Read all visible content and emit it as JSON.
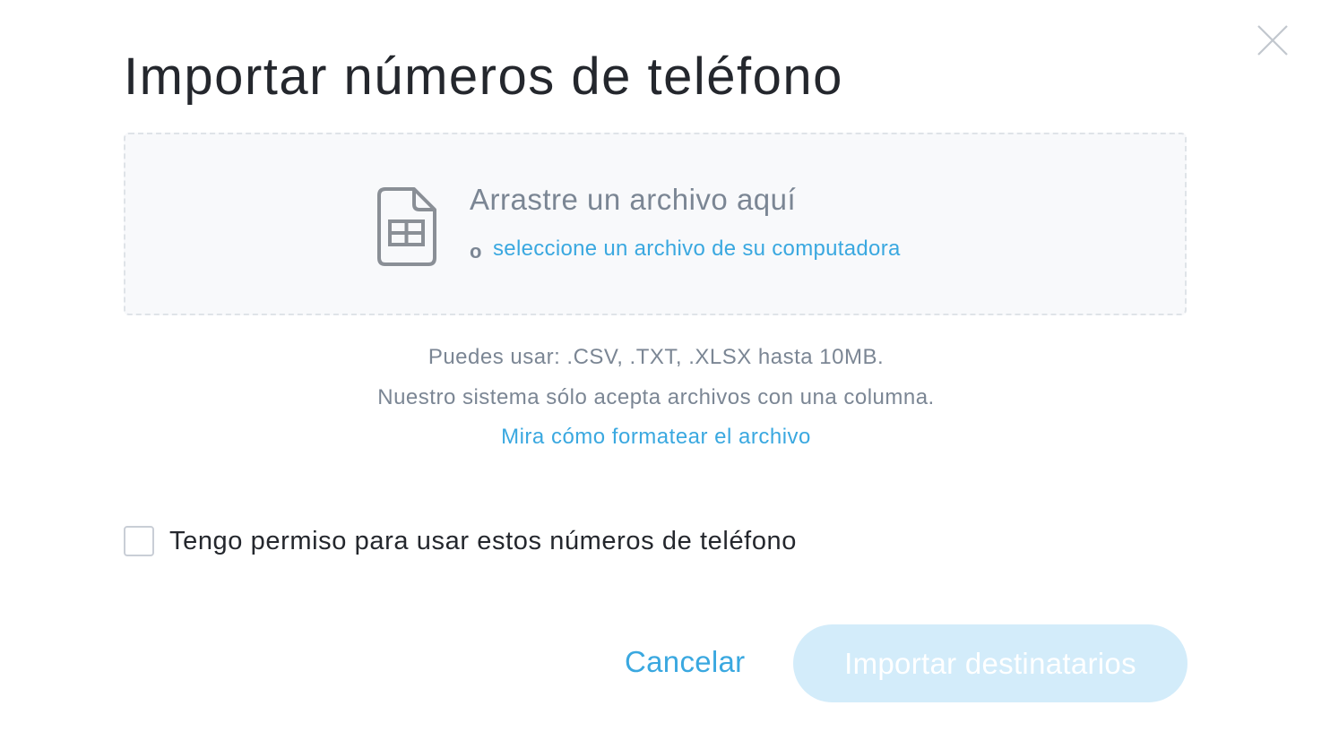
{
  "dialog": {
    "title": "Importar números de teléfono",
    "close_icon": "close-icon"
  },
  "dropzone": {
    "icon": "spreadsheet-file-icon",
    "title": "Arrastre un archivo aquí",
    "or_text": "o",
    "select_link": "seleccione un archivo de su computadora"
  },
  "info": {
    "formats": "Puedes usar: .CSV, .TXT, .XLSX hasta 10MB.",
    "columns": "Nuestro sistema sólo acepta archivos con una columna.",
    "format_link": "Mira cómo formatear el archivo"
  },
  "permission": {
    "checked": false,
    "label": "Tengo permiso para usar estos números de teléfono"
  },
  "actions": {
    "cancel_label": "Cancelar",
    "import_label": "Importar destinatarios",
    "import_enabled": false
  },
  "colors": {
    "accent": "#3aa8e0",
    "disabled_button": "#d3ecfa",
    "muted_text": "#7b8694",
    "title_text": "#24272d"
  }
}
